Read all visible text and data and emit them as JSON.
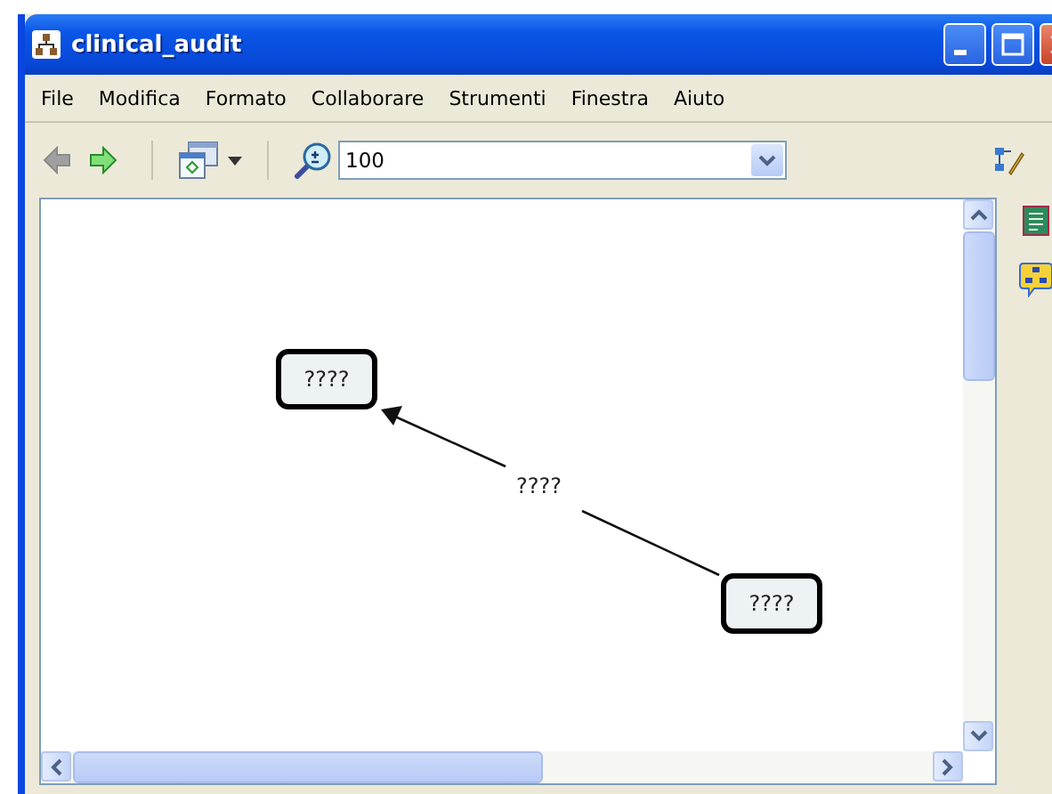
{
  "window": {
    "title": "clinical_audit"
  },
  "menu": [
    "File",
    "Modifica",
    "Formato",
    "Collaborare",
    "Strumenti",
    "Finestra",
    "Aiuto"
  ],
  "toolbar": {
    "navigation": [
      {
        "kind": "back",
        "disabled": true
      },
      {
        "kind": "forward",
        "disabled": false
      }
    ],
    "zoom": {
      "value": "100"
    }
  },
  "map": {
    "concepts": [
      {
        "label": "????"
      },
      {
        "label": "????"
      }
    ],
    "links": [
      {
        "label": "????"
      }
    ]
  }
}
